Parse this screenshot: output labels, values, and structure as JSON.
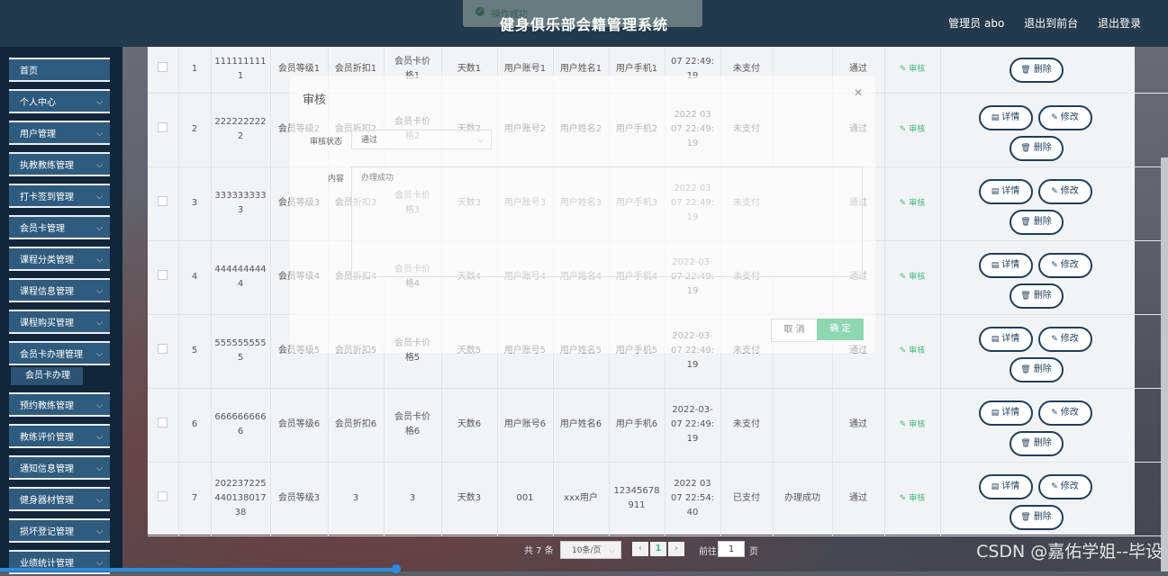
{
  "header": {
    "title": "健身俱乐部会籍管理系统",
    "admin_label": "管理员 abo",
    "front_label": "退出到前台",
    "logout_label": "退出登录"
  },
  "toast": {
    "text": "操作成功"
  },
  "sidebar": {
    "items": [
      {
        "label": "首页"
      },
      {
        "label": "个人中心"
      },
      {
        "label": "用户管理"
      },
      {
        "label": "执教教练管理"
      },
      {
        "label": "打卡签到管理"
      },
      {
        "label": "会员卡管理"
      },
      {
        "label": "课程分类管理"
      },
      {
        "label": "课程信息管理"
      },
      {
        "label": "课程购买管理"
      },
      {
        "label": "会员卡办理管理"
      },
      {
        "label": "预约教练管理"
      },
      {
        "label": "教练评价管理"
      },
      {
        "label": "通知信息管理"
      },
      {
        "label": "健身器材管理"
      },
      {
        "label": "损坏登记管理"
      },
      {
        "label": "业绩统计管理"
      }
    ],
    "sub_item": "会员卡办理"
  },
  "table": {
    "rows": [
      {
        "idx": "1",
        "card_no": "111111111\n1",
        "level": "会员等级1",
        "discount": "会员折扣1",
        "price": "会员卡价\n格1",
        "days": "天数1",
        "account": "用户账号1",
        "name": "用户姓名1",
        "phone": "用户手机1",
        "time": "07 22:49:\n19",
        "pay": "未支付",
        "reply": "",
        "status": "通过"
      },
      {
        "idx": "2",
        "card_no": "222222222\n2",
        "level": "会员等级2",
        "discount": "会员折扣2",
        "price": "会员卡价\n格2",
        "days": "天数2",
        "account": "用户账号2",
        "name": "用户姓名2",
        "phone": "用户手机2",
        "time": "2022 03\n07 22:49:\n19",
        "pay": "未支付",
        "reply": "",
        "status": "通过"
      },
      {
        "idx": "3",
        "card_no": "333333333\n3",
        "level": "会员等级3",
        "discount": "会员折扣3",
        "price": "会员卡价\n格3",
        "days": "天数3",
        "account": "用户账号3",
        "name": "用户姓名3",
        "phone": "用户手机3",
        "time": "2022 03\n07 22:49:\n19",
        "pay": "未支付",
        "reply": "",
        "status": "通过"
      },
      {
        "idx": "4",
        "card_no": "444444444\n4",
        "level": "会员等级4",
        "discount": "会员折扣4",
        "price": "会员卡价\n格4",
        "days": "天数4",
        "account": "用户账号4",
        "name": "用户姓名4",
        "phone": "用户手机4",
        "time": "2022-03-\n07 22:49:\n19",
        "pay": "未支付",
        "reply": "",
        "status": "通过"
      },
      {
        "idx": "5",
        "card_no": "555555555\n5",
        "level": "会员等级5",
        "discount": "会员折扣5",
        "price": "会员卡价\n格5",
        "days": "天数5",
        "account": "用户账号5",
        "name": "用户姓名5",
        "phone": "用户手机5",
        "time": "2022-03-\n07 22:49:\n19",
        "pay": "未支付",
        "reply": "",
        "status": "通过"
      },
      {
        "idx": "6",
        "card_no": "666666666\n6",
        "level": "会员等级6",
        "discount": "会员折扣6",
        "price": "会员卡价\n格6",
        "days": "天数6",
        "account": "用户账号6",
        "name": "用户姓名6",
        "phone": "用户手机6",
        "time": "2022-03-\n07 22:49:\n19",
        "pay": "未支付",
        "reply": "",
        "status": "通过"
      },
      {
        "idx": "7",
        "card_no": "202237225\n440138017\n38",
        "level": "会员等级3",
        "discount": "3",
        "price": "3",
        "days": "天数3",
        "account": "001",
        "name": "xxx用户",
        "phone": "12345678\n911",
        "time": "2022 03\n07 22:54:\n40",
        "pay": "已支付",
        "reply": "办理成功",
        "status": "通过"
      }
    ],
    "audit_label": "审核",
    "detail_label": "详情",
    "edit_label": "修改",
    "delete_label": "删除"
  },
  "dialog": {
    "title": "审核",
    "status_label": "审核状态",
    "status_value": "通过",
    "content_label": "内容",
    "content_value": "办理成功",
    "cancel_label": "取 消",
    "ok_label": "确 定"
  },
  "pagination": {
    "total": "共 7 条",
    "page_size": "10条/页",
    "current": "1",
    "goto_label": "前往",
    "goto_value": "1",
    "page_unit": "页"
  },
  "watermark": "CSDN @嘉佑学姐--毕设"
}
